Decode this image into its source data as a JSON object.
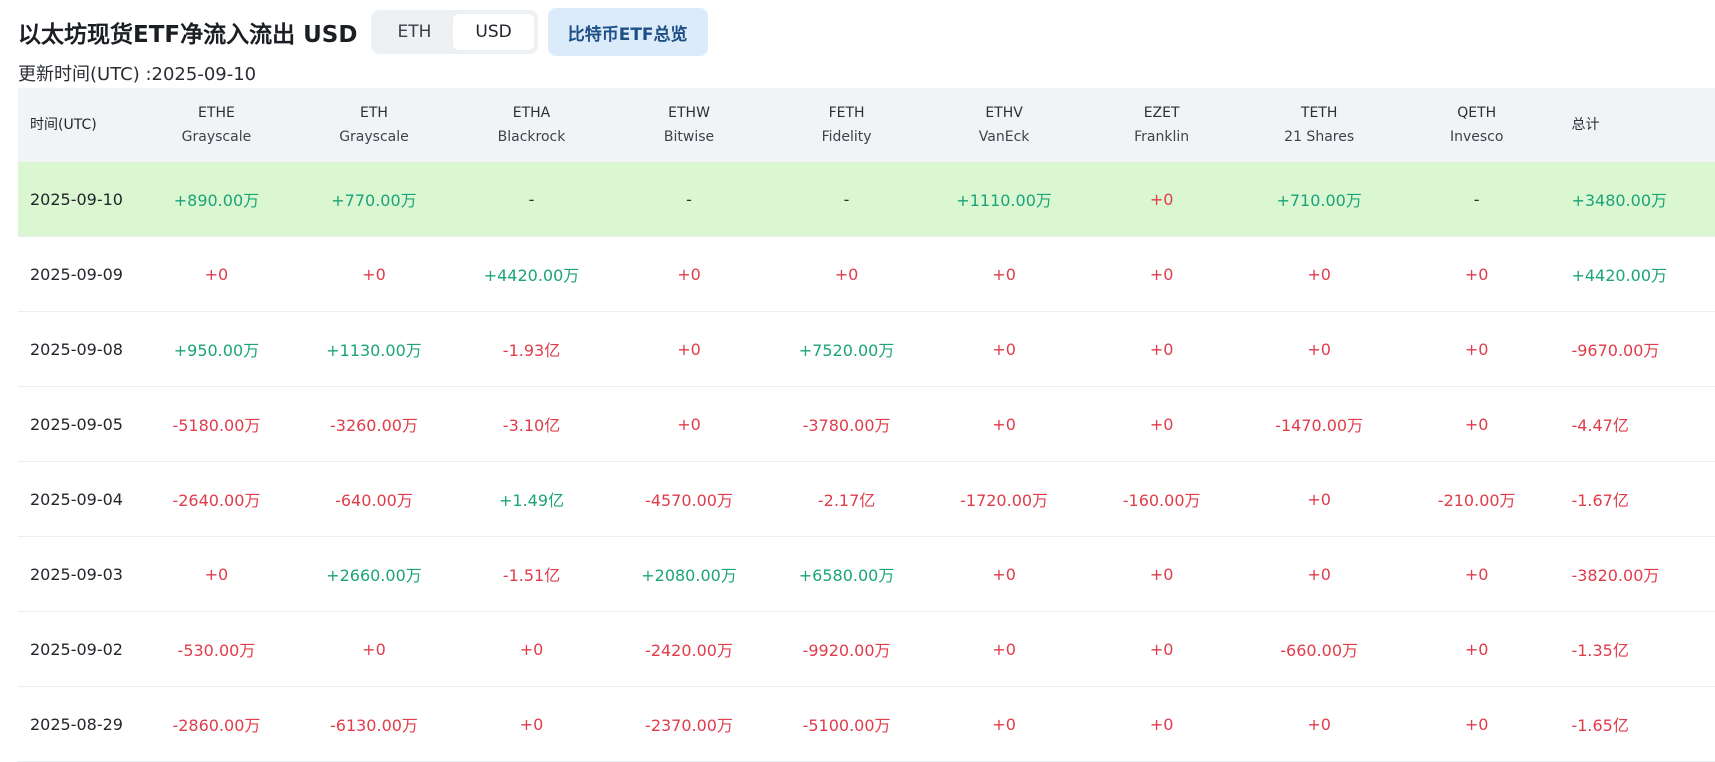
{
  "header": {
    "title": "以太坊现货ETF净流入流出 USD",
    "toggle": {
      "eth_label": "ETH",
      "usd_label": "USD",
      "active": "USD"
    },
    "overview_label": "比特币ETF总览",
    "updated": "更新时间(UTC) :2025-09-10"
  },
  "colors": {
    "positive": "#1ba37a",
    "negative": "#e03c4a",
    "highlight_row": "#dbf7d1",
    "header_bg": "#f1f4f7"
  },
  "table": {
    "date_header": "时间(UTC)",
    "total_header": "总计",
    "columns": [
      {
        "ticker": "ETHE",
        "issuer": "Grayscale"
      },
      {
        "ticker": "ETH",
        "issuer": "Grayscale"
      },
      {
        "ticker": "ETHA",
        "issuer": "Blackrock"
      },
      {
        "ticker": "ETHW",
        "issuer": "Bitwise"
      },
      {
        "ticker": "FETH",
        "issuer": "Fidelity"
      },
      {
        "ticker": "ETHV",
        "issuer": "VanEck"
      },
      {
        "ticker": "EZET",
        "issuer": "Franklin"
      },
      {
        "ticker": "TETH",
        "issuer": "21 Shares"
      },
      {
        "ticker": "QETH",
        "issuer": "Invesco"
      }
    ],
    "rows": [
      {
        "date": "2025-09-10",
        "values": [
          "+890.00万",
          "+770.00万",
          "-",
          "-",
          "-",
          "+1110.00万",
          "+0",
          "+710.00万",
          "-"
        ],
        "total": "+3480.00万"
      },
      {
        "date": "2025-09-09",
        "values": [
          "+0",
          "+0",
          "+4420.00万",
          "+0",
          "+0",
          "+0",
          "+0",
          "+0",
          "+0"
        ],
        "total": "+4420.00万"
      },
      {
        "date": "2025-09-08",
        "values": [
          "+950.00万",
          "+1130.00万",
          "-1.93亿",
          "+0",
          "+7520.00万",
          "+0",
          "+0",
          "+0",
          "+0"
        ],
        "total": "-9670.00万"
      },
      {
        "date": "2025-09-05",
        "values": [
          "-5180.00万",
          "-3260.00万",
          "-3.10亿",
          "+0",
          "-3780.00万",
          "+0",
          "+0",
          "-1470.00万",
          "+0"
        ],
        "total": "-4.47亿"
      },
      {
        "date": "2025-09-04",
        "values": [
          "-2640.00万",
          "-640.00万",
          "+1.49亿",
          "-4570.00万",
          "-2.17亿",
          "-1720.00万",
          "-160.00万",
          "+0",
          "-210.00万"
        ],
        "total": "-1.67亿"
      },
      {
        "date": "2025-09-03",
        "values": [
          "+0",
          "+2660.00万",
          "-1.51亿",
          "+2080.00万",
          "+6580.00万",
          "+0",
          "+0",
          "+0",
          "+0"
        ],
        "total": "-3820.00万"
      },
      {
        "date": "2025-09-02",
        "values": [
          "-530.00万",
          "+0",
          "+0",
          "-2420.00万",
          "-9920.00万",
          "+0",
          "+0",
          "-660.00万",
          "+0"
        ],
        "total": "-1.35亿"
      },
      {
        "date": "2025-08-29",
        "values": [
          "-2860.00万",
          "-6130.00万",
          "+0",
          "-2370.00万",
          "-5100.00万",
          "+0",
          "+0",
          "+0",
          "+0"
        ],
        "total": "-1.65亿"
      }
    ]
  }
}
